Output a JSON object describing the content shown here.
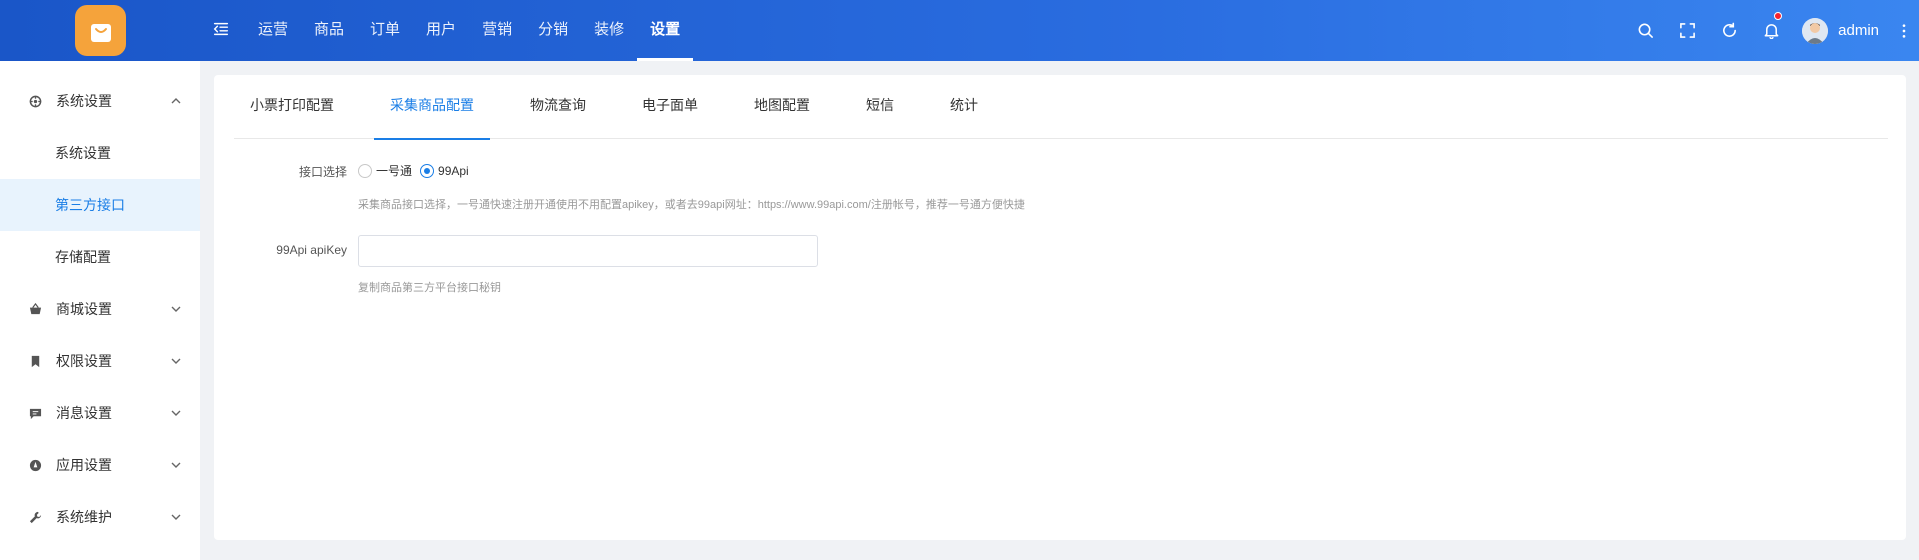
{
  "header": {
    "nav": [
      "运营",
      "商品",
      "订单",
      "用户",
      "营销",
      "分销",
      "装修",
      "设置"
    ],
    "active_nav_index": 7,
    "username": "admin",
    "colors": {
      "gradient_start": "#1a56c8",
      "gradient_end": "#3a86f0",
      "logo_bg": "#f5a33b",
      "notification_dot": "#f5222d"
    }
  },
  "sidebar": {
    "groups": [
      {
        "label": "系统设置",
        "icon": "gear-icon",
        "expanded": true,
        "children": [
          "系统设置",
          "第三方接口",
          "存储配置"
        ],
        "active_child_index": 1
      },
      {
        "label": "商城设置",
        "icon": "basket-icon",
        "expanded": false
      },
      {
        "label": "权限设置",
        "icon": "bookmark-icon",
        "expanded": false
      },
      {
        "label": "消息设置",
        "icon": "message-icon",
        "expanded": false
      },
      {
        "label": "应用设置",
        "icon": "compass-icon",
        "expanded": false
      },
      {
        "label": "系统维护",
        "icon": "wrench-icon",
        "expanded": false
      }
    ]
  },
  "tabs": {
    "items": [
      "小票打印配置",
      "采集商品配置",
      "物流查询",
      "电子面单",
      "地图配置",
      "短信",
      "统计"
    ],
    "active_index": 1,
    "accent": "#1a7ee6"
  },
  "form": {
    "interface_label": "接口选择",
    "options": [
      "一号通",
      "99Api"
    ],
    "selected_option": "99Api",
    "interface_hint": "采集商品接口选择，一号通快速注册开通使用不用配置apikey，或者去99api网址：https://www.99api.com/注册帐号，推荐一号通方便快捷",
    "apikey_label": "99Api apiKey",
    "apikey_value": "",
    "apikey_hint": "复制商品第三方平台接口秘钥"
  }
}
